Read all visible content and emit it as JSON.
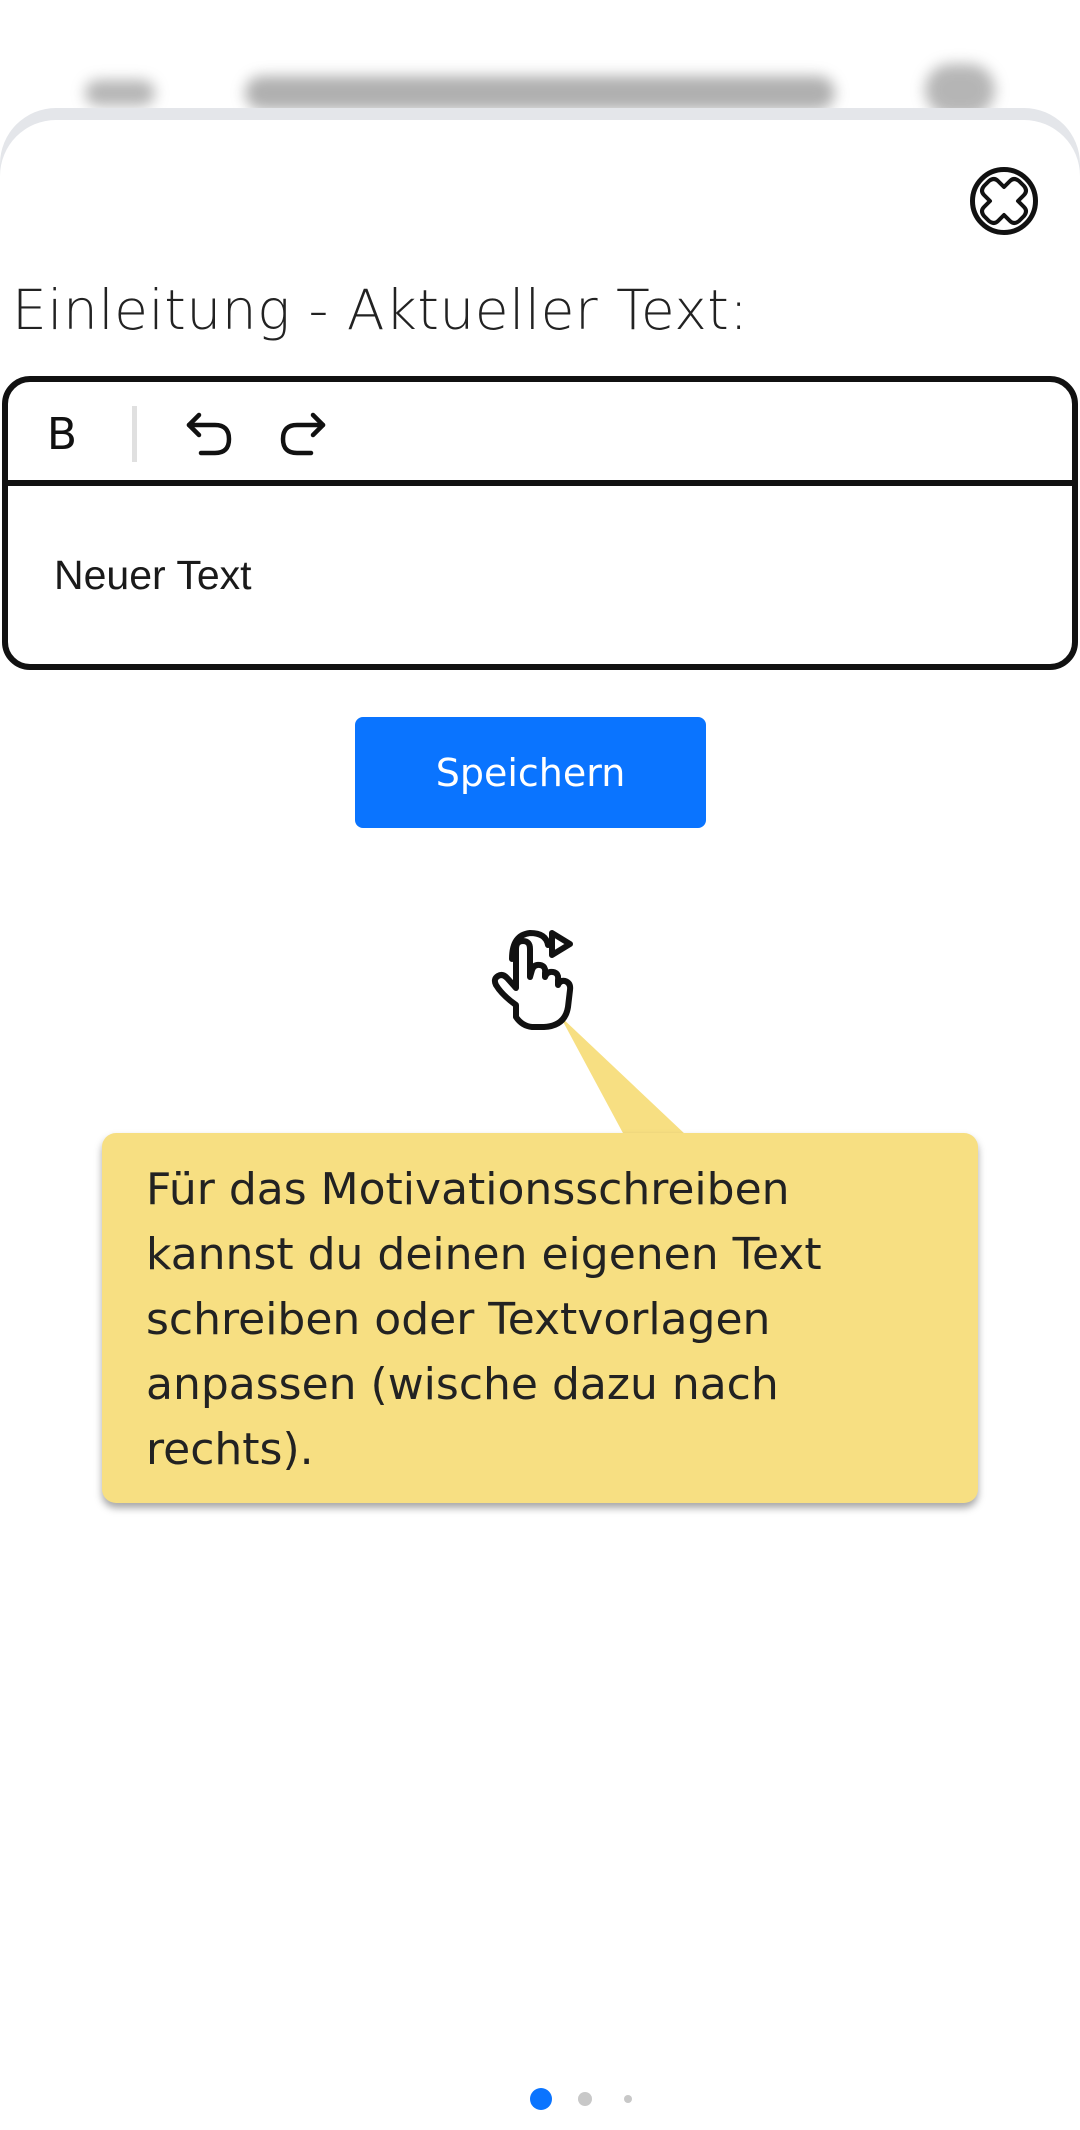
{
  "background_header": {
    "back_icon": "arrow-left-icon",
    "title_blurred": true,
    "menu_icon": "menu-icon"
  },
  "close_icon": "close-circle-icon",
  "section": {
    "title": "Einleitung - Aktueller Text:"
  },
  "editor": {
    "toolbar": {
      "bold_label": "B",
      "undo_icon": "undo-icon",
      "redo_icon": "redo-icon"
    },
    "content": "Neuer Text"
  },
  "save_button": {
    "label": "Speichern"
  },
  "gesture_icon": "swipe-right-hand-icon",
  "tooltip": {
    "text": "Für das Motivationsschreiben kannst du deinen eigenen Text schreiben oder Textvorlagen anpassen (wische dazu nach rechts)."
  },
  "pagination": {
    "pages": 3,
    "active": 1
  },
  "colors": {
    "accent": "#0a74ff",
    "tooltip_background": "#f7df82",
    "text": "#222222",
    "border": "#111111"
  }
}
